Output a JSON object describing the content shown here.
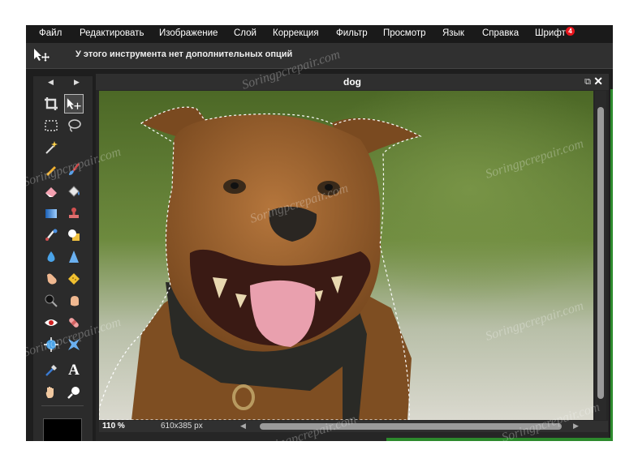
{
  "menu": {
    "items": [
      "Файл",
      "Редактировать",
      "Изображение",
      "Слой",
      "Коррекция",
      "Фильтр",
      "Просмотр",
      "Язык",
      "Справка",
      "Шрифт"
    ],
    "badge": "4"
  },
  "options_bar": {
    "text": "У этого инструмента нет дополнительных опций"
  },
  "toolbox": {
    "tools": [
      "crop-icon",
      "move-icon",
      "marquee-select-icon",
      "lasso-icon",
      "magic-wand-icon",
      "pencil-icon",
      "brush-icon",
      "eraser-icon",
      "paint-bucket-icon",
      "gradient-icon",
      "clone-stamp-icon",
      "color-replace-icon",
      "drawing-icon",
      "blur-icon",
      "sharpen-icon",
      "smudge-icon",
      "sponge-icon",
      "dodge-icon",
      "burn-icon",
      "red-eye-icon",
      "spot-heal-icon",
      "bloat-icon",
      "pinch-icon",
      "color-picker-icon",
      "type-icon",
      "hand-icon",
      "zoom-icon"
    ],
    "type_glyph": "A",
    "foreground_color": "#000000"
  },
  "document": {
    "title": "dog",
    "zoom": "110 %",
    "size": "610x385 px"
  },
  "watermark": {
    "text": "Soringpcrepair.com"
  }
}
